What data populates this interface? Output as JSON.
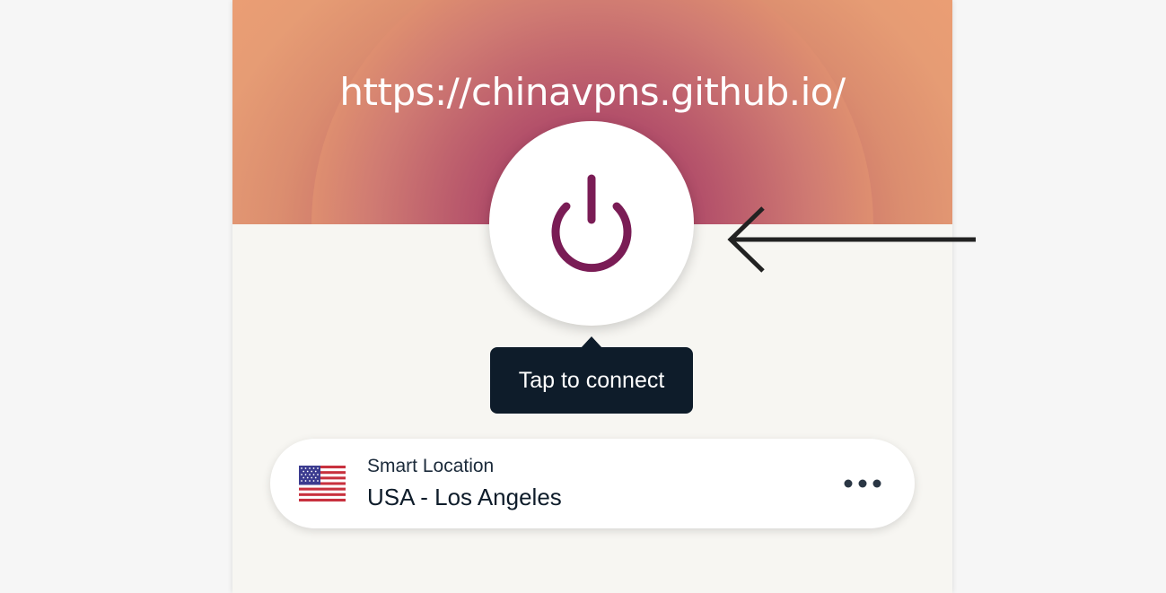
{
  "watermark": {
    "text": "https://chinavpns.github.io/"
  },
  "connect": {
    "power_icon": "power-icon",
    "tooltip": "Tap to connect"
  },
  "location": {
    "flag_icon": "us-flag-icon",
    "label": "Smart Location",
    "name": "USA - Los Angeles",
    "more_icon": "more-options-icon"
  },
  "annotation": {
    "arrow_icon": "left-arrow-icon"
  },
  "colors": {
    "accent": "#7a1c55",
    "tooltip_bg": "#0e1c2a",
    "hero_inner": "#9a2e5c",
    "hero_outer": "#ee9f74",
    "app_bg": "#f7f6f2"
  }
}
